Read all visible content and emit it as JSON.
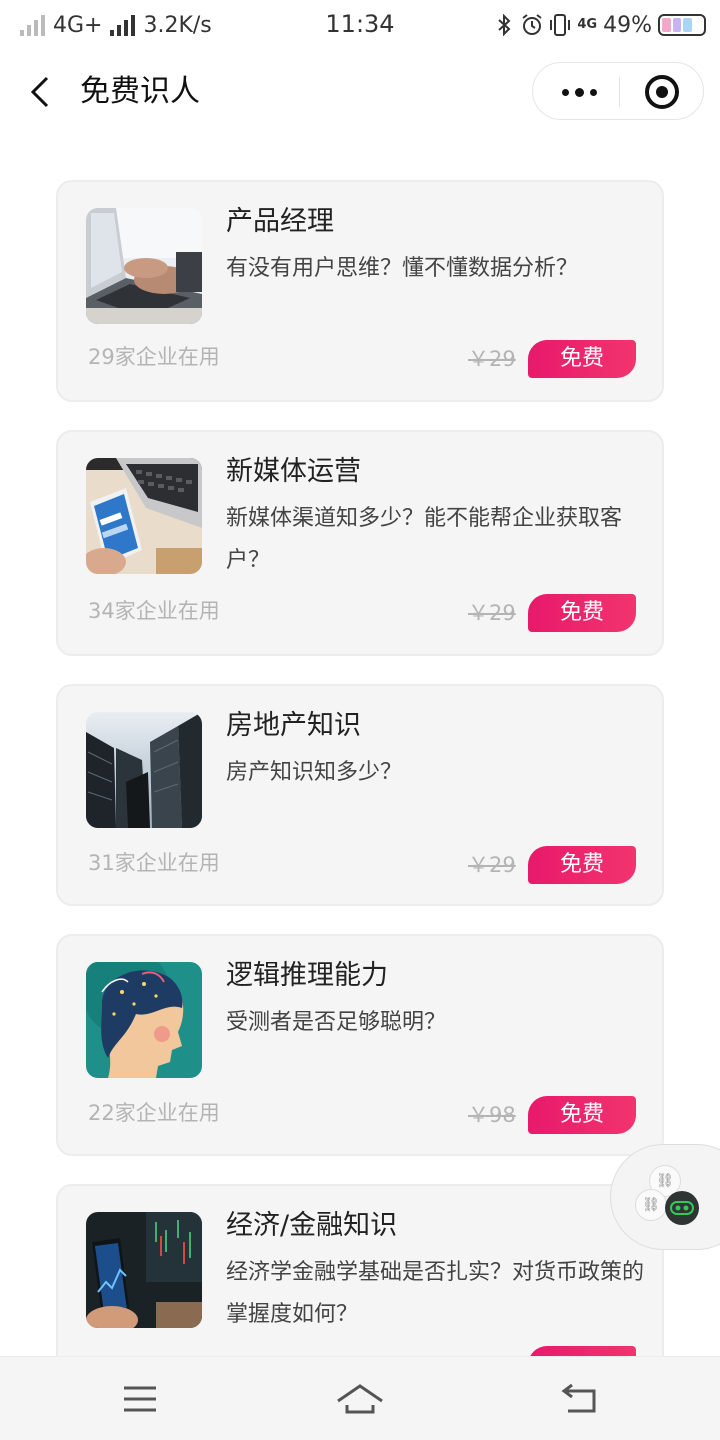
{
  "status_bar": {
    "network_type": "4G+",
    "speed": "3.2K/s",
    "time": "11:34",
    "network_type_2": "4G",
    "battery_percent": "49%",
    "battery_level": 0.49
  },
  "nav": {
    "title": "免费识人"
  },
  "cards": [
    {
      "title": "产品经理",
      "description": "有没有用户思维？懂不懂数据分析？",
      "usage": "29家企业在用",
      "original_price": "￥29",
      "badge": "免费",
      "thumb_icon": "laptop-typing-photo"
    },
    {
      "title": "新媒体运营",
      "description": "新媒体渠道知多少？能不能帮企业获取客户？",
      "usage": "34家企业在用",
      "original_price": "￥29",
      "badge": "免费",
      "thumb_icon": "phone-laptop-photo"
    },
    {
      "title": "房地产知识",
      "description": "房产知识知多少？",
      "usage": "31家企业在用",
      "original_price": "￥29",
      "badge": "免费",
      "thumb_icon": "skyscrapers-photo"
    },
    {
      "title": "逻辑推理能力",
      "description": "受测者是否足够聪明？",
      "usage": "22家企业在用",
      "original_price": "￥98",
      "badge": "免费",
      "thumb_icon": "thinking-head-illustration"
    },
    {
      "title": "经济/金融知识",
      "description": "经济学金融学基础是否扎实？对货币政策的掌握度如何？",
      "usage": "",
      "original_price": "",
      "badge": "",
      "thumb_icon": "stock-phone-photo"
    }
  ],
  "colors": {
    "badge_gradient_start": "#e8196b",
    "badge_gradient_end": "#f2346e",
    "card_background": "#f5f5f5"
  }
}
